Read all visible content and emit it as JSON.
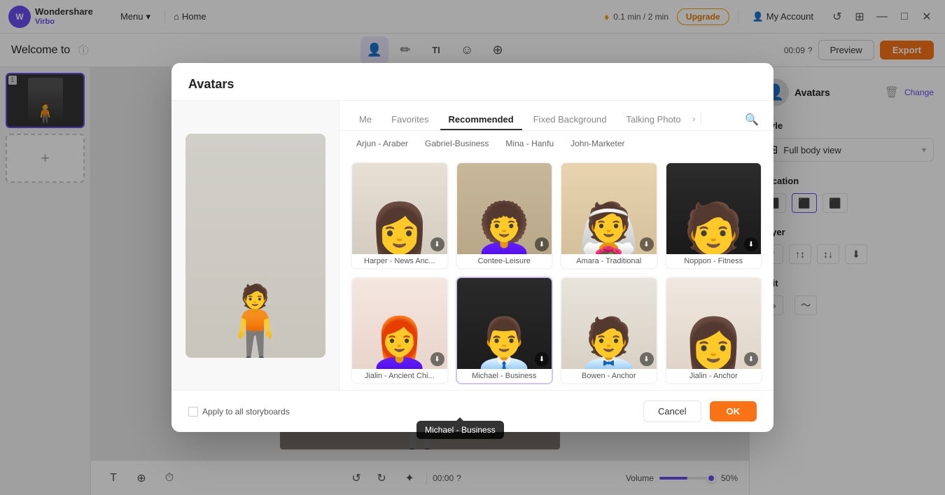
{
  "app": {
    "logo_brand": "Wondershare",
    "logo_product": "Virbo",
    "menu_label": "Menu",
    "home_label": "Home",
    "credit_text": "0.1 min / 2 min",
    "upgrade_label": "Upgrade",
    "account_label": "My Account"
  },
  "subtoolbar": {
    "welcome_text": "Welcome to",
    "time": "00:09",
    "preview_label": "Preview",
    "export_label": "Export"
  },
  "modal": {
    "title": "Avatars",
    "tabs": [
      {
        "id": "me",
        "label": "Me"
      },
      {
        "id": "favorites",
        "label": "Favorites"
      },
      {
        "id": "recommended",
        "label": "Recommended"
      },
      {
        "id": "fixed_bg",
        "label": "Fixed Background"
      },
      {
        "id": "talking_photo",
        "label": "Talking Photo"
      }
    ],
    "active_tab": "recommended",
    "subtabs": [
      {
        "id": "all",
        "label": "Arjun - Araber"
      },
      {
        "id": "gabriel",
        "label": "Gabriel-Business"
      },
      {
        "id": "mina",
        "label": "Mina - Hanfu"
      },
      {
        "id": "john",
        "label": "John-Marketer"
      }
    ],
    "avatars": [
      {
        "id": "harper",
        "name": "Harper - News Anc...",
        "bg_class": "av-harper"
      },
      {
        "id": "contee",
        "name": "Contee-Leisure",
        "bg_class": "av-contee"
      },
      {
        "id": "amara",
        "name": "Amara - Traditional",
        "bg_class": "av-amara"
      },
      {
        "id": "noppon",
        "name": "Noppon - Fitness",
        "bg_class": "av-noppon"
      },
      {
        "id": "jialin",
        "name": "Jialin - Ancient Chi...",
        "bg_class": "av-jialin"
      },
      {
        "id": "michael",
        "name": "Michael - Business",
        "bg_class": "av-michael"
      },
      {
        "id": "bowen",
        "name": "Bowen - Anchor",
        "bg_class": "av-bowen"
      },
      {
        "id": "jialin2",
        "name": "Jialin - Anchor",
        "bg_class": "av-jialin2"
      }
    ],
    "apply_all_label": "Apply to all storyboards",
    "cancel_label": "Cancel",
    "ok_label": "OK"
  },
  "right_panel": {
    "avatars_label": "Avatars",
    "change_label": "Change",
    "style_label": "Style",
    "style_value": "Full body view",
    "location_label": "Location",
    "layer_label": "Layer",
    "edit_label": "Edit"
  },
  "bottom_bar": {
    "time": "00:00",
    "volume_label": "Volume",
    "volume_percent": "50%"
  },
  "tooltip": {
    "text": "Michael - Business"
  }
}
